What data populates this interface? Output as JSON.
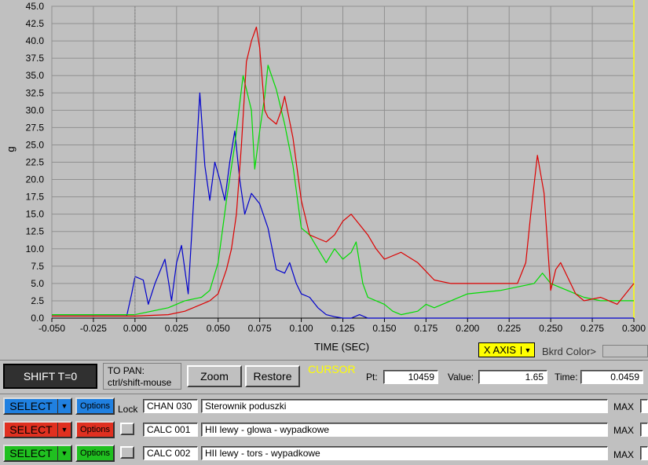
{
  "chart_data": {
    "type": "line",
    "xlabel": "TIME (SEC)",
    "ylabel": "g",
    "xlim": [
      -0.05,
      0.3
    ],
    "ylim": [
      0,
      45
    ],
    "x_ticks": [
      "-0.050",
      "-0.025",
      "0.000",
      "0.025",
      "0.050",
      "0.075",
      "0.100",
      "0.125",
      "0.150",
      "0.175",
      "0.200",
      "0.225",
      "0.250",
      "0.275",
      "0.300"
    ],
    "y_ticks": [
      "0.0",
      "2.5",
      "5.0",
      "7.5",
      "10.0",
      "12.5",
      "15.0",
      "17.5",
      "20.0",
      "22.5",
      "25.0",
      "27.5",
      "30.0",
      "32.5",
      "35.0",
      "37.5",
      "40.0",
      "42.5",
      "45.0"
    ],
    "grid": true,
    "cursor_time": 0.0459,
    "series": [
      {
        "color": "#0000cc",
        "x": [
          -0.05,
          -0.005,
          -0.002,
          0.0,
          0.005,
          0.008,
          0.012,
          0.018,
          0.022,
          0.025,
          0.028,
          0.032,
          0.036,
          0.039,
          0.042,
          0.045,
          0.048,
          0.051,
          0.054,
          0.057,
          0.06,
          0.063,
          0.066,
          0.07,
          0.075,
          0.08,
          0.085,
          0.09,
          0.093,
          0.097,
          0.1,
          0.105,
          0.11,
          0.115,
          0.12,
          0.125,
          0.13,
          0.135,
          0.14,
          0.15,
          0.2,
          0.25,
          0.3
        ],
        "y": [
          0.3,
          0.3,
          3.5,
          6.0,
          5.5,
          2.0,
          5.0,
          8.5,
          2.5,
          8.0,
          10.5,
          3.5,
          20.0,
          32.5,
          22.0,
          17.0,
          22.5,
          20.0,
          17.0,
          22.5,
          27.0,
          20.0,
          15.0,
          18.0,
          16.5,
          13.0,
          7.0,
          6.5,
          8.0,
          5.0,
          3.5,
          3.0,
          1.5,
          0.5,
          0.2,
          0.0,
          0.0,
          0.5,
          0.0,
          0.0,
          0.0,
          0.0,
          0.0
        ]
      },
      {
        "color": "#00dd00",
        "x": [
          -0.05,
          0.0,
          0.02,
          0.03,
          0.04,
          0.045,
          0.05,
          0.055,
          0.06,
          0.065,
          0.07,
          0.072,
          0.075,
          0.078,
          0.08,
          0.085,
          0.09,
          0.095,
          0.1,
          0.105,
          0.11,
          0.115,
          0.12,
          0.125,
          0.13,
          0.133,
          0.137,
          0.14,
          0.15,
          0.155,
          0.16,
          0.17,
          0.175,
          0.18,
          0.19,
          0.2,
          0.22,
          0.24,
          0.245,
          0.25,
          0.26,
          0.27,
          0.28,
          0.3
        ],
        "y": [
          0.5,
          0.5,
          1.5,
          2.5,
          3.0,
          4.0,
          8.0,
          17.0,
          25.0,
          35.0,
          30.0,
          21.5,
          27.0,
          32.0,
          36.5,
          33.0,
          28.0,
          22.0,
          13.0,
          12.0,
          10.0,
          8.0,
          10.0,
          8.5,
          9.5,
          11.0,
          5.0,
          3.0,
          2.0,
          1.0,
          0.5,
          1.0,
          2.0,
          1.5,
          2.5,
          3.5,
          4.0,
          5.0,
          6.5,
          5.0,
          4.0,
          3.0,
          2.5,
          2.5
        ]
      },
      {
        "color": "#dd0000",
        "x": [
          -0.05,
          0.0,
          0.02,
          0.03,
          0.035,
          0.04,
          0.045,
          0.05,
          0.055,
          0.058,
          0.061,
          0.064,
          0.067,
          0.07,
          0.073,
          0.075,
          0.078,
          0.08,
          0.085,
          0.088,
          0.09,
          0.095,
          0.1,
          0.105,
          0.11,
          0.115,
          0.12,
          0.125,
          0.13,
          0.135,
          0.14,
          0.145,
          0.15,
          0.16,
          0.17,
          0.18,
          0.19,
          0.2,
          0.21,
          0.22,
          0.23,
          0.235,
          0.238,
          0.242,
          0.246,
          0.25,
          0.253,
          0.256,
          0.26,
          0.265,
          0.27,
          0.28,
          0.29,
          0.3
        ],
        "y": [
          0.3,
          0.3,
          0.5,
          1.0,
          1.5,
          2.0,
          2.5,
          3.5,
          7.0,
          10.0,
          15.0,
          25.0,
          37.0,
          40.0,
          42.0,
          39.0,
          30.0,
          29.0,
          28.0,
          30.0,
          32.0,
          26.0,
          17.0,
          12.0,
          11.5,
          11.0,
          12.0,
          14.0,
          15.0,
          13.5,
          12.0,
          10.0,
          8.5,
          9.5,
          8.0,
          5.5,
          5.0,
          5.0,
          5.0,
          5.0,
          5.0,
          8.0,
          15.0,
          23.5,
          18.0,
          4.0,
          7.0,
          8.0,
          6.0,
          3.5,
          2.5,
          3.0,
          2.0,
          5.0
        ]
      }
    ]
  },
  "toolbar": {
    "shift_label": "SHIFT T=0",
    "pan_line1": "TO PAN:",
    "pan_line2": "ctrl/shift-mouse",
    "zoom_label": "Zoom",
    "restore_label": "Restore",
    "cursor_label": "CURSOR",
    "pt_label": "Pt:",
    "pt_value": "10459",
    "value_label": "Value:",
    "value_value": "1.65",
    "time_label": "Time:",
    "time_value": "0.0459"
  },
  "axis_controls": {
    "x_axis_label": "X AXIS",
    "bkrd_color_label": "Bkrd Color>"
  },
  "channels": [
    {
      "select_label": "SELECT",
      "options_label": "Options",
      "lock_label": "Lock",
      "code": "CHAN 030",
      "name": "Sterownik poduszki",
      "max_label": "MAX",
      "color": "#2080e0"
    },
    {
      "select_label": "SELECT",
      "options_label": "Options",
      "code": "CALC 001",
      "name": "HII lewy - glowa - wypadkowe",
      "max_label": "MAX",
      "color": "#e03020"
    },
    {
      "select_label": "SELECT",
      "options_label": "Options",
      "code": "CALC 002",
      "name": "HII lewy - tors - wypadkowe",
      "max_label": "MAX",
      "color": "#20c020"
    }
  ]
}
